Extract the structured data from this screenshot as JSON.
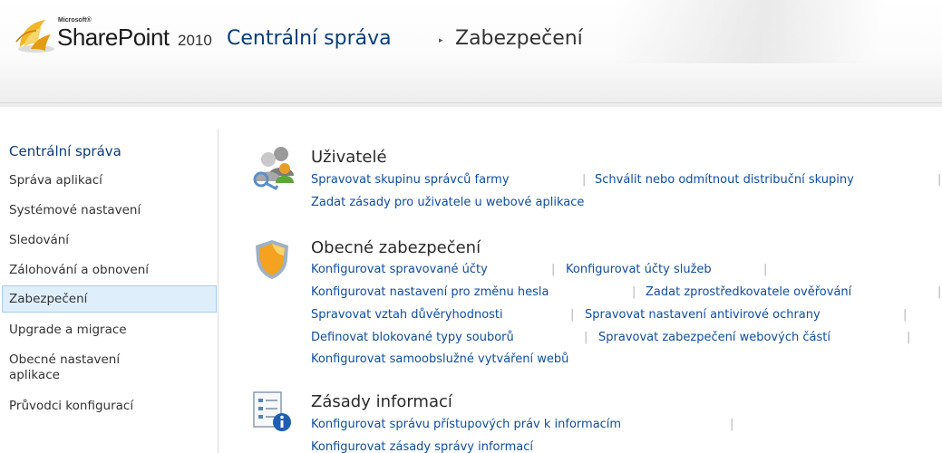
{
  "header": {
    "brand_small": "Microsoft®",
    "brand_name": "SharePoint",
    "brand_year": "2010",
    "breadcrumb_root": "Centrální správa",
    "breadcrumb_sep": "▸",
    "breadcrumb_current": "Zabezpečení"
  },
  "nav": {
    "heading": "Centrální správa",
    "items": [
      "Správa aplikací",
      "Systémové nastavení",
      "Sledování",
      "Zálohování a obnovení",
      "Zabezpečení",
      "Upgrade a migrace",
      "Obecné nastavení aplikace",
      "Průvodci konfigurací"
    ],
    "selected_index": 4
  },
  "sections": [
    {
      "title": "Uživatelé",
      "icon": "users-icon",
      "links": [
        "Spravovat skupinu správců farmy",
        "Schválit nebo odmítnout distribuční skupiny",
        "Zadat zásady pro uživatele u webové aplikace"
      ]
    },
    {
      "title": "Obecné zabezpečení",
      "icon": "shield-icon",
      "links": [
        "Konfigurovat spravované účty",
        "Konfigurovat účty služeb",
        "Konfigurovat nastavení pro změnu hesla",
        "Zadat zprostředkovatele ověřování",
        "Spravovat vztah důvěryhodnosti",
        "Spravovat nastavení antivirové ochrany",
        "Definovat blokované typy souborů",
        "Spravovat zabezpečení webových částí",
        "Konfigurovat samoobslužné vytváření webů"
      ]
    },
    {
      "title": "Zásady informací",
      "icon": "information-policy-icon",
      "links": [
        "Konfigurovat správu přístupových práv k informacím",
        "Konfigurovat zásady správy informací"
      ]
    }
  ],
  "separator": "|"
}
